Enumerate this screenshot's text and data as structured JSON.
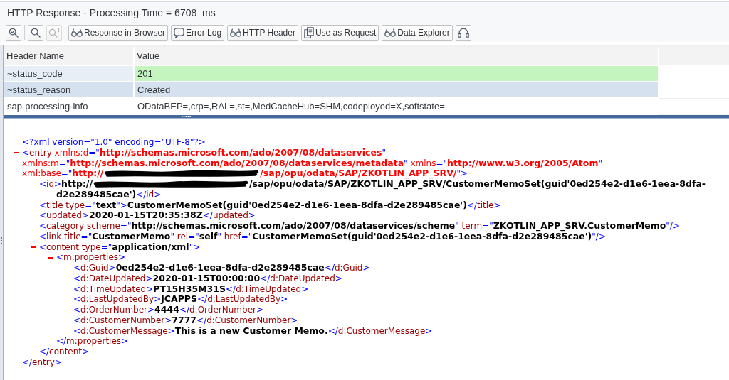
{
  "title_bar": {
    "title": "HTTP Response - Processing Time = 6708  ms"
  },
  "toolbar": {
    "groups": [
      [
        {
          "kind": "icon",
          "disabled": false
        }
      ],
      [
        {
          "kind": "icon",
          "disabled": false
        },
        {
          "kind": "icon",
          "disabled": true
        }
      ],
      [
        {
          "kind": "labeled",
          "label": "Response in Browser",
          "disabled": false
        },
        {
          "kind": "labeled",
          "label": "Error Log",
          "disabled": false
        },
        {
          "kind": "labeled",
          "label": "HTTP Header",
          "disabled": false
        },
        {
          "kind": "labeled",
          "label": "Use as Request",
          "disabled": false
        },
        {
          "kind": "labeled",
          "label": "Data Explorer",
          "disabled": false
        },
        {
          "kind": "icon",
          "disabled": false
        }
      ]
    ]
  },
  "header_table": {
    "columns": [
      "Header Name",
      "Value"
    ],
    "rows": [
      {
        "name": "~status_code",
        "value": "201",
        "selected": false,
        "hovered": true,
        "color": "#c4f5bf"
      },
      {
        "name": "~status_reason",
        "value": "Created",
        "selected": true,
        "hovered": false
      },
      {
        "name": "sap-processing-info",
        "value": "ODataBEP=,crp=,RAL=,st=,MedCacheHub=SHM,codeployed=X,softstate=",
        "selected": false,
        "hovered": false
      }
    ]
  },
  "xml_document": {
    "declaration": {
      "kind": "tag",
      "tokens": [
        {
          "kind": "pi",
          "text": "<?xml version=\"1.0\" encoding=\"UTF-8\"?>"
        }
      ]
    },
    "root": {
      "expanded": true,
      "lines": [
        {
          "kind": "tag",
          "tokens": [
            {
              "kind": "markup",
              "text": "<"
            },
            {
              "kind": "name",
              "text": "entry"
            },
            {
              "kind": "ns",
              "text": " xmlns:d"
            },
            {
              "kind": "markup",
              "text": "=\""
            },
            {
              "kind": "ns_value",
              "text": "http://schemas.microsoft.com/ado/2007/08/dataservices"
            },
            {
              "kind": "markup",
              "text": "\""
            }
          ]
        },
        {
          "kind": "tag",
          "tokens": [
            {
              "kind": "ns",
              "text": "xmlns:m"
            },
            {
              "kind": "markup",
              "text": "=\""
            },
            {
              "kind": "ns_value",
              "text": "http://schemas.microsoft.com/ado/2007/08/dataservices/metadata"
            },
            {
              "kind": "markup",
              "text": "\""
            },
            {
              "kind": "ns",
              "text": " xmlns"
            },
            {
              "kind": "markup",
              "text": "=\""
            },
            {
              "kind": "ns_value",
              "text": "http://www.w3.org/2005/Atom"
            },
            {
              "kind": "markup",
              "text": "\""
            }
          ]
        },
        {
          "kind": "tag",
          "tokens": [
            {
              "kind": "ns",
              "text": "xml:base"
            },
            {
              "kind": "markup",
              "text": "=\""
            },
            {
              "kind": "ns_value",
              "text": "http://"
            },
            {
              "kind": "redacted"
            },
            {
              "kind": "ns_value",
              "text": "/sap/opu/odata/SAP/ZKOTLIN_APP_SRV/"
            },
            {
              "kind": "markup",
              "text": "\">"
            }
          ]
        }
      ],
      "children": [
        {
          "lines": [
            {
              "kind": "tag",
              "tokens": [
                {
                  "kind": "markup",
                  "text": "<"
                },
                {
                  "kind": "name",
                  "text": "id"
                },
                {
                  "kind": "markup",
                  "text": ">"
                },
                {
                  "kind": "value",
                  "text": "http://"
                },
                {
                  "kind": "redacted"
                },
                {
                  "kind": "value",
                  "text": "/sap/opu/odata/SAP/ZKOTLIN_APP_SRV/CustomerMemoSet(guid'0ed254e2-d1e6-1eea-8dfa-"
                }
              ]
            },
            {
              "kind": "text",
              "tokens": [
                {
                  "kind": "value",
                  "text": "d2e289485cae')"
                },
                {
                  "kind": "markup",
                  "text": "</"
                },
                {
                  "kind": "name",
                  "text": "id"
                },
                {
                  "kind": "markup",
                  "text": ">"
                }
              ]
            }
          ]
        },
        {
          "lines": [
            {
              "kind": "tag",
              "tokens": [
                {
                  "kind": "markup",
                  "text": "<"
                },
                {
                  "kind": "name",
                  "text": "title"
                },
                {
                  "kind": "name",
                  "text": " type"
                },
                {
                  "kind": "markup",
                  "text": "=\""
                },
                {
                  "kind": "value",
                  "text": "text"
                },
                {
                  "kind": "markup",
                  "text": "\">"
                },
                {
                  "kind": "value",
                  "text": "CustomerMemoSet(guid'0ed254e2-d1e6-1eea-8dfa-d2e289485cae')"
                },
                {
                  "kind": "markup",
                  "text": "</"
                },
                {
                  "kind": "name",
                  "text": "title"
                },
                {
                  "kind": "markup",
                  "text": ">"
                }
              ]
            }
          ]
        },
        {
          "lines": [
            {
              "kind": "tag",
              "tokens": [
                {
                  "kind": "markup",
                  "text": "<"
                },
                {
                  "kind": "name",
                  "text": "updated"
                },
                {
                  "kind": "markup",
                  "text": ">"
                },
                {
                  "kind": "value",
                  "text": "2020-01-15T20:35:38Z"
                },
                {
                  "kind": "markup",
                  "text": "</"
                },
                {
                  "kind": "name",
                  "text": "updated"
                },
                {
                  "kind": "markup",
                  "text": ">"
                }
              ]
            }
          ]
        },
        {
          "lines": [
            {
              "kind": "tag",
              "tokens": [
                {
                  "kind": "markup",
                  "text": "<"
                },
                {
                  "kind": "name",
                  "text": "category"
                },
                {
                  "kind": "name",
                  "text": " scheme"
                },
                {
                  "kind": "markup",
                  "text": "=\""
                },
                {
                  "kind": "value",
                  "text": "http://schemas.microsoft.com/ado/2007/08/dataservices/scheme"
                },
                {
                  "kind": "markup",
                  "text": "\""
                },
                {
                  "kind": "name",
                  "text": " term"
                },
                {
                  "kind": "markup",
                  "text": "=\""
                },
                {
                  "kind": "value",
                  "text": "ZKOTLIN_APP_SRV.CustomerMemo"
                },
                {
                  "kind": "markup",
                  "text": "\"/>"
                }
              ]
            }
          ]
        },
        {
          "lines": [
            {
              "kind": "tag",
              "tokens": [
                {
                  "kind": "markup",
                  "text": "<"
                },
                {
                  "kind": "name",
                  "text": "link"
                },
                {
                  "kind": "name",
                  "text": " title"
                },
                {
                  "kind": "markup",
                  "text": "=\""
                },
                {
                  "kind": "value",
                  "text": "CustomerMemo"
                },
                {
                  "kind": "markup",
                  "text": "\""
                },
                {
                  "kind": "name",
                  "text": " rel"
                },
                {
                  "kind": "markup",
                  "text": "=\""
                },
                {
                  "kind": "value",
                  "text": "self"
                },
                {
                  "kind": "markup",
                  "text": "\""
                },
                {
                  "kind": "name",
                  "text": " href"
                },
                {
                  "kind": "markup",
                  "text": "=\""
                },
                {
                  "kind": "value",
                  "text": "CustomerMemoSet(guid'0ed254e2-d1e6-1eea-8dfa-d2e289485cae')"
                },
                {
                  "kind": "markup",
                  "text": "\"/>"
                }
              ]
            }
          ]
        },
        {
          "expanded": true,
          "lines": [
            {
              "kind": "tag",
              "tokens": [
                {
                  "kind": "markup",
                  "text": "<"
                },
                {
                  "kind": "name",
                  "text": "content"
                },
                {
                  "kind": "name",
                  "text": " type"
                },
                {
                  "kind": "markup",
                  "text": "=\""
                },
                {
                  "kind": "value",
                  "text": "application/xml"
                },
                {
                  "kind": "markup",
                  "text": "\">"
                }
              ]
            }
          ],
          "children": [
            {
              "expanded": true,
              "lines": [
                {
                  "kind": "tag",
                  "tokens": [
                    {
                      "kind": "markup",
                      "text": "<"
                    },
                    {
                      "kind": "name",
                      "text": "m:properties"
                    },
                    {
                      "kind": "markup",
                      "text": ">"
                    }
                  ]
                }
              ],
              "children": [
                {
                  "lines": [
                    {
                      "kind": "tag",
                      "tokens": [
                        {
                          "kind": "markup",
                          "text": "<"
                        },
                        {
                          "kind": "name",
                          "text": "d:Guid"
                        },
                        {
                          "kind": "markup",
                          "text": ">"
                        },
                        {
                          "kind": "value",
                          "text": "0ed254e2-d1e6-1eea-8dfa-d2e289485cae"
                        },
                        {
                          "kind": "markup",
                          "text": "</"
                        },
                        {
                          "kind": "name",
                          "text": "d:Guid"
                        },
                        {
                          "kind": "markup",
                          "text": ">"
                        }
                      ]
                    }
                  ]
                },
                {
                  "lines": [
                    {
                      "kind": "tag",
                      "tokens": [
                        {
                          "kind": "markup",
                          "text": "<"
                        },
                        {
                          "kind": "name",
                          "text": "d:DateUpdated"
                        },
                        {
                          "kind": "markup",
                          "text": ">"
                        },
                        {
                          "kind": "value",
                          "text": "2020-01-15T00:00:00"
                        },
                        {
                          "kind": "markup",
                          "text": "</"
                        },
                        {
                          "kind": "name",
                          "text": "d:DateUpdated"
                        },
                        {
                          "kind": "markup",
                          "text": ">"
                        }
                      ]
                    }
                  ]
                },
                {
                  "lines": [
                    {
                      "kind": "tag",
                      "tokens": [
                        {
                          "kind": "markup",
                          "text": "<"
                        },
                        {
                          "kind": "name",
                          "text": "d:TimeUpdated"
                        },
                        {
                          "kind": "markup",
                          "text": ">"
                        },
                        {
                          "kind": "value",
                          "text": "PT15H35M31S"
                        },
                        {
                          "kind": "markup",
                          "text": "</"
                        },
                        {
                          "kind": "name",
                          "text": "d:TimeUpdated"
                        },
                        {
                          "kind": "markup",
                          "text": ">"
                        }
                      ]
                    }
                  ]
                },
                {
                  "lines": [
                    {
                      "kind": "tag",
                      "tokens": [
                        {
                          "kind": "markup",
                          "text": "<"
                        },
                        {
                          "kind": "name",
                          "text": "d:LastUpdatedBy"
                        },
                        {
                          "kind": "markup",
                          "text": ">"
                        },
                        {
                          "kind": "value",
                          "text": "JCAPPS"
                        },
                        {
                          "kind": "markup",
                          "text": "</"
                        },
                        {
                          "kind": "name",
                          "text": "d:LastUpdatedBy"
                        },
                        {
                          "kind": "markup",
                          "text": ">"
                        }
                      ]
                    }
                  ]
                },
                {
                  "lines": [
                    {
                      "kind": "tag",
                      "tokens": [
                        {
                          "kind": "markup",
                          "text": "<"
                        },
                        {
                          "kind": "name",
                          "text": "d:OrderNumber"
                        },
                        {
                          "kind": "markup",
                          "text": ">"
                        },
                        {
                          "kind": "value",
                          "text": "4444"
                        },
                        {
                          "kind": "markup",
                          "text": "</"
                        },
                        {
                          "kind": "name",
                          "text": "d:OrderNumber"
                        },
                        {
                          "kind": "markup",
                          "text": ">"
                        }
                      ]
                    }
                  ]
                },
                {
                  "lines": [
                    {
                      "kind": "tag",
                      "tokens": [
                        {
                          "kind": "markup",
                          "text": "<"
                        },
                        {
                          "kind": "name",
                          "text": "d:CustomerNumber"
                        },
                        {
                          "kind": "markup",
                          "text": ">"
                        },
                        {
                          "kind": "value",
                          "text": "7777"
                        },
                        {
                          "kind": "markup",
                          "text": "</"
                        },
                        {
                          "kind": "name",
                          "text": "d:CustomerNumber"
                        },
                        {
                          "kind": "markup",
                          "text": ">"
                        }
                      ]
                    }
                  ]
                },
                {
                  "lines": [
                    {
                      "kind": "tag",
                      "tokens": [
                        {
                          "kind": "markup",
                          "text": "<"
                        },
                        {
                          "kind": "name",
                          "text": "d:CustomerMessage"
                        },
                        {
                          "kind": "markup",
                          "text": ">"
                        },
                        {
                          "kind": "value",
                          "text": "This is a new Customer Memo."
                        },
                        {
                          "kind": "markup",
                          "text": "</"
                        },
                        {
                          "kind": "name",
                          "text": "d:CustomerMessage"
                        },
                        {
                          "kind": "markup",
                          "text": ">"
                        }
                      ]
                    }
                  ]
                }
              ],
              "close": {
                "kind": "tag",
                "tokens": [
                  {
                    "kind": "markup",
                    "text": "</"
                  },
                  {
                    "kind": "name",
                    "text": "m:properties"
                  },
                  {
                    "kind": "markup",
                    "text": ">"
                  }
                ]
              }
            }
          ],
          "close": {
            "kind": "tag",
            "tokens": [
              {
                "kind": "markup",
                "text": "</"
              },
              {
                "kind": "name",
                "text": "content"
              },
              {
                "kind": "markup",
                "text": ">"
              }
            ]
          }
        }
      ],
      "close": {
        "kind": "tag",
        "tokens": [
          {
            "kind": "markup",
            "text": "</"
          },
          {
            "kind": "name",
            "text": "entry"
          },
          {
            "kind": "markup",
            "text": ">"
          }
        ]
      }
    }
  }
}
